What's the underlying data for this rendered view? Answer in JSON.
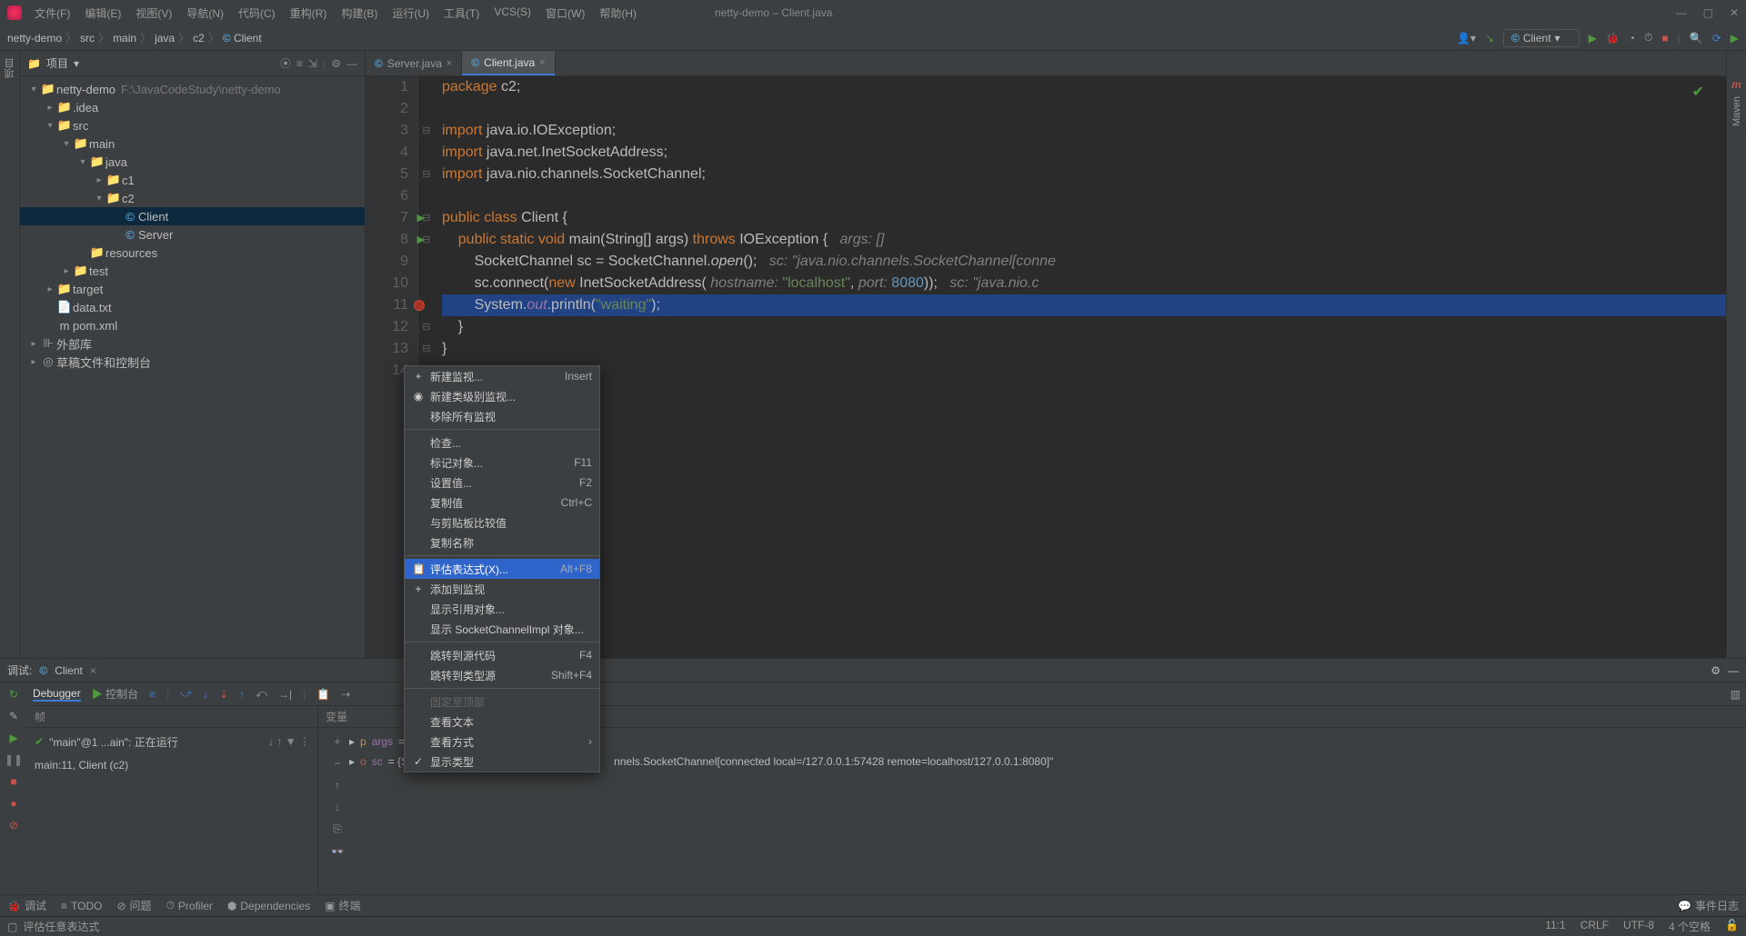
{
  "titlebar": {
    "menus": [
      "文件(F)",
      "编辑(E)",
      "视图(V)",
      "导航(N)",
      "代码(C)",
      "重构(R)",
      "构建(B)",
      "运行(U)",
      "工具(T)",
      "VCS(S)",
      "窗口(W)",
      "帮助(H)"
    ],
    "title": "netty-demo – Client.java"
  },
  "breadcrumb": [
    "netty-demo",
    "src",
    "main",
    "java",
    "c2",
    "Client"
  ],
  "runConfig": "Client",
  "sidebar": {
    "tool": "项目"
  },
  "projectPanel": {
    "title": "项目",
    "tree": [
      {
        "depth": 0,
        "arrow": "▾",
        "icon": "folder",
        "label": "netty-demo",
        "hint": "F:\\JavaCodeStudy\\netty-demo"
      },
      {
        "depth": 1,
        "arrow": "▸",
        "icon": "folder",
        "label": ".idea"
      },
      {
        "depth": 1,
        "arrow": "▾",
        "icon": "folder-blue",
        "label": "src"
      },
      {
        "depth": 2,
        "arrow": "▾",
        "icon": "folder-blue",
        "label": "main"
      },
      {
        "depth": 3,
        "arrow": "▾",
        "icon": "folder-blue",
        "label": "java"
      },
      {
        "depth": 4,
        "arrow": "▸",
        "icon": "folder",
        "label": "c1"
      },
      {
        "depth": 4,
        "arrow": "▾",
        "icon": "folder",
        "label": "c2"
      },
      {
        "depth": 5,
        "arrow": "",
        "icon": "class",
        "label": "Client",
        "selected": true
      },
      {
        "depth": 5,
        "arrow": "",
        "icon": "class",
        "label": "Server"
      },
      {
        "depth": 3,
        "arrow": "",
        "icon": "folder",
        "label": "resources"
      },
      {
        "depth": 2,
        "arrow": "▸",
        "icon": "folder",
        "label": "test"
      },
      {
        "depth": 1,
        "arrow": "▸",
        "icon": "folder-orange",
        "label": "target"
      },
      {
        "depth": 1,
        "arrow": "",
        "icon": "file",
        "label": "data.txt"
      },
      {
        "depth": 1,
        "arrow": "",
        "icon": "maven",
        "label": "pom.xml"
      },
      {
        "depth": 0,
        "arrow": "▸",
        "icon": "lib",
        "label": "外部库"
      },
      {
        "depth": 0,
        "arrow": "▸",
        "icon": "scratch",
        "label": "草稿文件和控制台"
      }
    ]
  },
  "editorTabs": [
    {
      "label": "Server.java",
      "active": false
    },
    {
      "label": "Client.java",
      "active": true
    }
  ],
  "code": {
    "lines": [
      {
        "n": 1,
        "fold": "",
        "html": "<span class='kw'>package</span> c2;"
      },
      {
        "n": 2,
        "fold": "",
        "html": ""
      },
      {
        "n": 3,
        "fold": "⊟",
        "html": "<span class='kw'>import</span> java.io.IOException;"
      },
      {
        "n": 4,
        "fold": "",
        "html": "<span class='kw'>import</span> java.net.InetSocketAddress;"
      },
      {
        "n": 5,
        "fold": "⊟",
        "html": "<span class='kw'>import</span> java.nio.channels.SocketChannel;"
      },
      {
        "n": 6,
        "fold": "",
        "html": ""
      },
      {
        "n": 7,
        "fold": "⊟",
        "run": true,
        "html": "<span class='kw'>public class</span> Client {"
      },
      {
        "n": 8,
        "fold": "⊟",
        "run": true,
        "html": "    <span class='kw'>public static void</span> main(String[] args) <span class='kw'>throws</span> IOException {   <span class='cmt'>args: []</span>"
      },
      {
        "n": 9,
        "fold": "",
        "html": "        SocketChannel sc = SocketChannel.<span class='fn'>open</span>();   <span class='cmt'>sc: \"java.nio.channels.SocketChannel[conne</span>"
      },
      {
        "n": 10,
        "fold": "",
        "html": "        sc.connect(<span class='kw'>new</span> InetSocketAddress( <span class='cmt'>hostname:</span> <span class='str'>\"localhost\"</span>, <span class='cmt'>port:</span> <span class='num'>8080</span>));   <span class='cmt'>sc: \"java.nio.c</span>"
      },
      {
        "n": 11,
        "fold": "",
        "bp": true,
        "hl": true,
        "html": "        System.<span class='fld'>out</span>.println(<span class='str'>\"waiting\"</span>);"
      },
      {
        "n": 12,
        "fold": "⊟",
        "html": "    }"
      },
      {
        "n": 13,
        "fold": "⊟",
        "html": "}"
      },
      {
        "n": 14,
        "fold": "",
        "html": ""
      }
    ]
  },
  "debug": {
    "header": {
      "label": "调试:",
      "config": "Client"
    },
    "tabs": {
      "debugger": "Debugger",
      "console": "控制台"
    },
    "frames": {
      "title": "帧",
      "thread": "\"main\"@1 ...ain\": 正在运行",
      "stack": "main:11, Client (c2)"
    },
    "vars": {
      "title": "变量",
      "rows": [
        {
          "icon": "p",
          "name": "args",
          "val": "="
        },
        {
          "icon": "o",
          "name": "sc",
          "val": "= {S",
          "extra": "nnels.SocketChannel[connected local=/127.0.0.1:57428 remote=localhost/127.0.0.1:8080]\""
        }
      ]
    }
  },
  "contextMenu": {
    "items": [
      {
        "icon": "+",
        "label": "新建监视...",
        "shortcut": "Insert"
      },
      {
        "icon": "◉",
        "label": "新建类级别监视..."
      },
      {
        "label": "移除所有监视"
      },
      {
        "sep": true
      },
      {
        "label": "检查..."
      },
      {
        "label": "标记对象...",
        "shortcut": "F11"
      },
      {
        "label": "设置值...",
        "shortcut": "F2"
      },
      {
        "label": "复制值",
        "shortcut": "Ctrl+C"
      },
      {
        "label": "与剪贴板比较值"
      },
      {
        "label": "复制名称"
      },
      {
        "sep": true
      },
      {
        "icon": "📋",
        "label": "评估表达式(X)...",
        "shortcut": "Alt+F8",
        "highlight": true
      },
      {
        "icon": "+",
        "label": "添加到监视"
      },
      {
        "label": "显示引用对象..."
      },
      {
        "label": "显示 SocketChannelImpl 对象..."
      },
      {
        "sep": true
      },
      {
        "label": "跳转到源代码",
        "shortcut": "F4"
      },
      {
        "label": "跳转到类型源",
        "shortcut": "Shift+F4"
      },
      {
        "sep": true
      },
      {
        "label": "固定至顶部",
        "disabled": true
      },
      {
        "label": "查看文本"
      },
      {
        "label": "查看方式",
        "sub": true
      },
      {
        "icon": "✓",
        "label": "显示类型"
      }
    ]
  },
  "bottomBar": {
    "items": [
      "调试",
      "TODO",
      "问题",
      "Profiler",
      "Dependencies",
      "终端"
    ],
    "right": "事件日志"
  },
  "statusBar": {
    "left": "评估任意表达式",
    "right": [
      "11:1",
      "CRLF",
      "UTF-8",
      "4 个空格"
    ]
  },
  "rightGutter": "Maven"
}
